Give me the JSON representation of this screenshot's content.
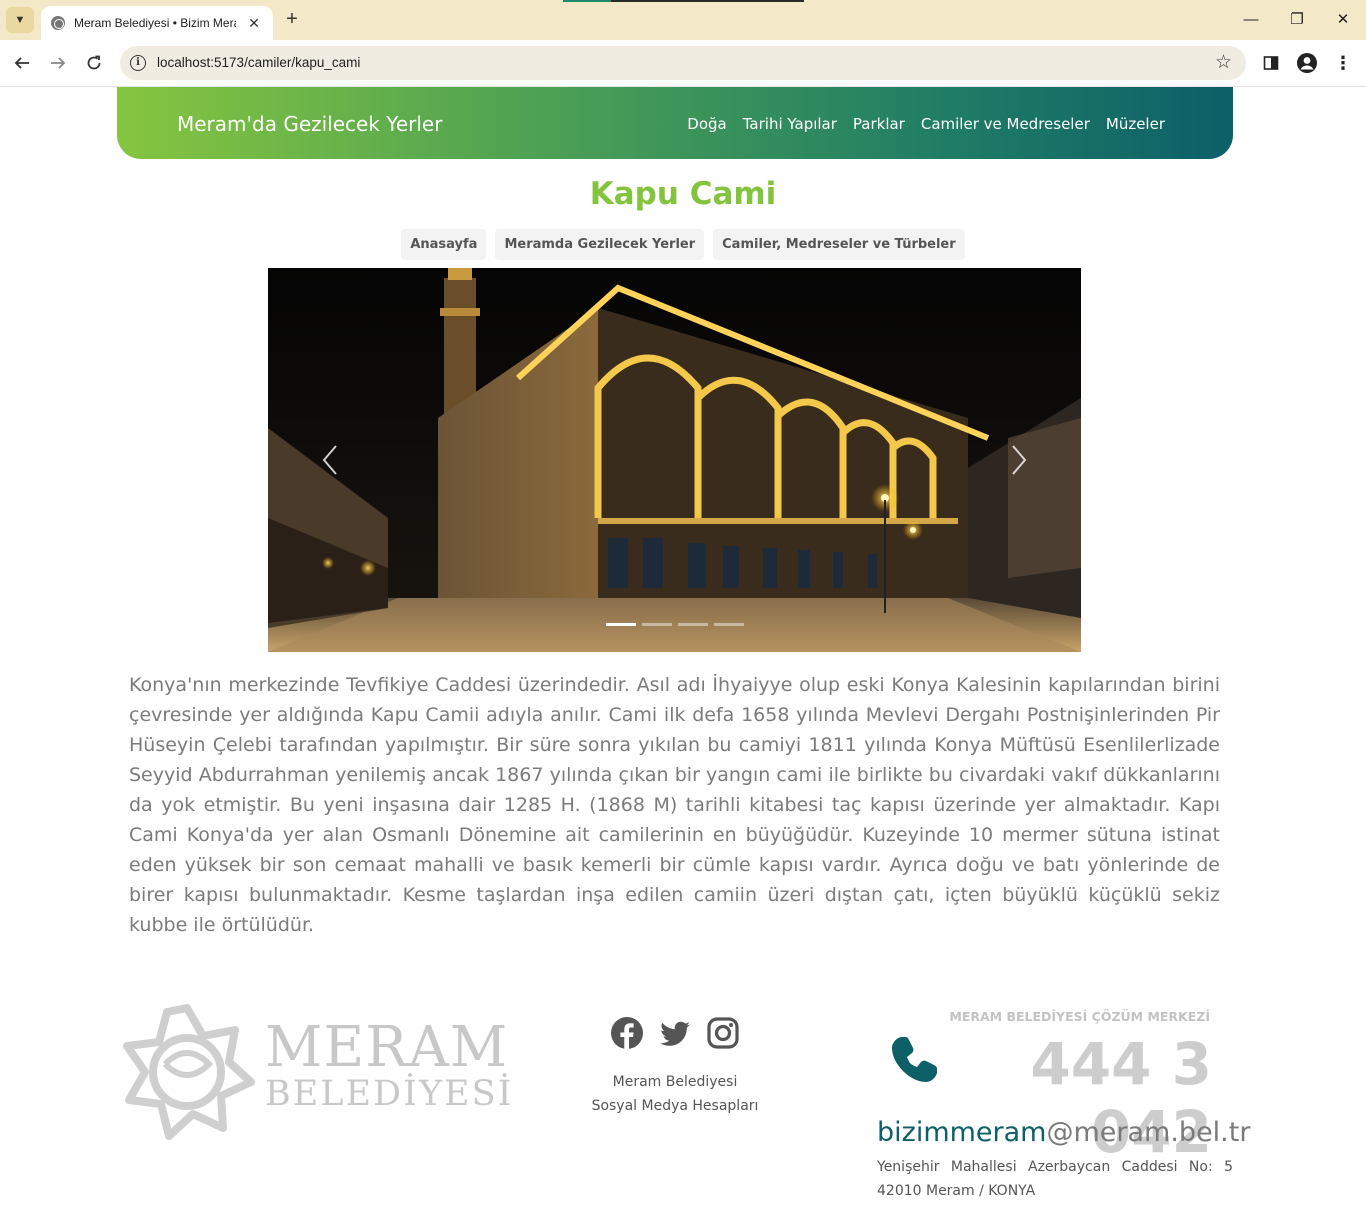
{
  "browser": {
    "tab_title": "Meram Belediyesi • Bizim Meram",
    "url": "localhost:5173/camiler/kapu_cami",
    "new_tab": "+",
    "tab_close": "✕",
    "controls": {
      "minimize": "—",
      "restore": "❐",
      "close": "✕"
    }
  },
  "header": {
    "brand": "Meram'da Gezilecek Yerler",
    "nav": [
      "Doğa",
      "Tarihi Yapılar",
      "Parklar",
      "Camiler ve Medreseler",
      "Müzeler"
    ]
  },
  "page": {
    "title": "Kapu Cami",
    "breadcrumb": [
      "Anasayfa",
      "Meramda Gezilecek Yerler",
      "Camiler, Medreseler ve Türbeler"
    ],
    "carousel": {
      "slides": 4,
      "active_index": 0
    },
    "description": "Konya'nın merkezinde Tevfikiye Caddesi üzerindedir. Asıl adı İhyaiyye olup eski Konya Kalesinin kapılarından birini çevresinde yer aldığında Kapu Camii adıyla anılır. Cami ilk defa 1658 yılında Mevlevi Dergahı Postnişinlerinden Pir Hüseyin Çelebi tarafından yapılmıştır. Bir süre sonra yıkılan bu camiyi 1811 yılında Konya Müftüsü Esenlilerlizade Seyyid Abdurrahman yenilemiş ancak 1867 yılında çıkan bir yangın cami ile birlikte bu civardaki vakıf dükkanlarını da yok etmiştir. Bu yeni inşasına dair 1285 H. (1868 M) tarihli kitabesi taç kapısı üzerinde yer almaktadır. Kapı Cami Konya'da yer alan Osmanlı Dönemine ait camilerinin en büyüğüdür. Kuzeyinde 10 mermer sütuna istinat eden yüksek bir son cemaat mahalli ve basık kemerli bir cümle kapısı vardır. Ayrıca doğu ve batı yönlerinde de birer kapısı bulunmaktadır. Kesme taşlardan inşa edilen camiin üzeri dıştan çatı, içten büyüklü küçüklü sekiz kubbe ile örtülüdür."
  },
  "footer": {
    "logo_line1": "MERAM",
    "logo_line2": "BELEDİYESİ",
    "social_icons": [
      "facebook-icon",
      "twitter-icon",
      "instagram-icon"
    ],
    "social_line1": "Meram Belediyesi",
    "social_line2": "Sosyal Medya Hesapları",
    "contact_title": "MERAM BELEDİYESİ ÇÖZÜM MERKEZİ",
    "phone": "444 3 042",
    "email_user": "bizimmeram",
    "email_domain": "@meram.bel.tr",
    "address_line1": "Yenişehir Mahallesi Azerbaycan Caddesi No: 5",
    "address_line2": "42010 Meram / KONYA"
  },
  "colors": {
    "accent_green": "#84c33e",
    "teal": "#0d5f68",
    "header_gradient_start": "#86c53f",
    "header_gradient_end": "#0d5f68"
  }
}
